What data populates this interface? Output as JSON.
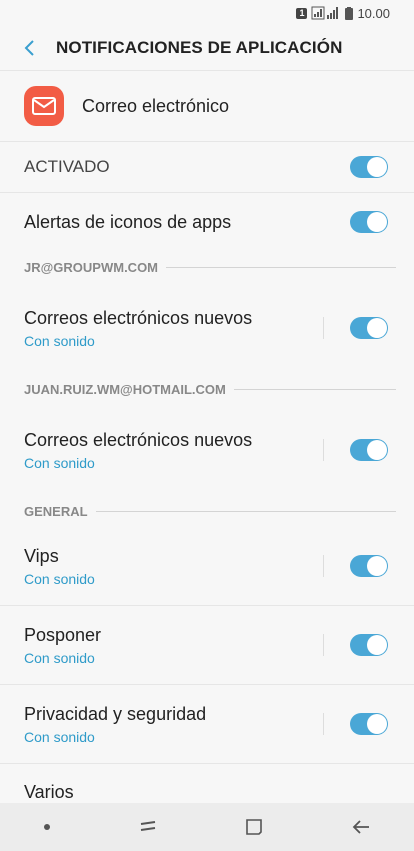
{
  "status": {
    "sim_badge": "1",
    "time": "10.00"
  },
  "header": {
    "title": "NOTIFICACIONES DE APLICACIÓN"
  },
  "app": {
    "name": "Correo electrónico"
  },
  "settings": {
    "activado": {
      "label": "ACTIVADO",
      "on": true
    },
    "alertas": {
      "label": "Alertas de iconos de apps",
      "on": true
    }
  },
  "sections": [
    {
      "title": "JR@GROUPWM.COM",
      "items": [
        {
          "label": "Correos electrónicos nuevos",
          "sub": "Con sonido",
          "on": true
        }
      ]
    },
    {
      "title": "JUAN.RUIZ.WM@HOTMAIL.COM",
      "items": [
        {
          "label": "Correos electrónicos nuevos",
          "sub": "Con sonido",
          "on": true
        }
      ]
    },
    {
      "title": "GENERAL",
      "items": [
        {
          "label": "Vips",
          "sub": "Con sonido",
          "on": true
        },
        {
          "label": "Posponer",
          "sub": "Con sonido",
          "on": true
        },
        {
          "label": "Privacidad y seguridad",
          "sub": "Con sonido",
          "on": true
        },
        {
          "label": "Varios"
        }
      ]
    }
  ],
  "colors": {
    "accent": "#4aa7d6",
    "app_icon": "#f25c45"
  }
}
